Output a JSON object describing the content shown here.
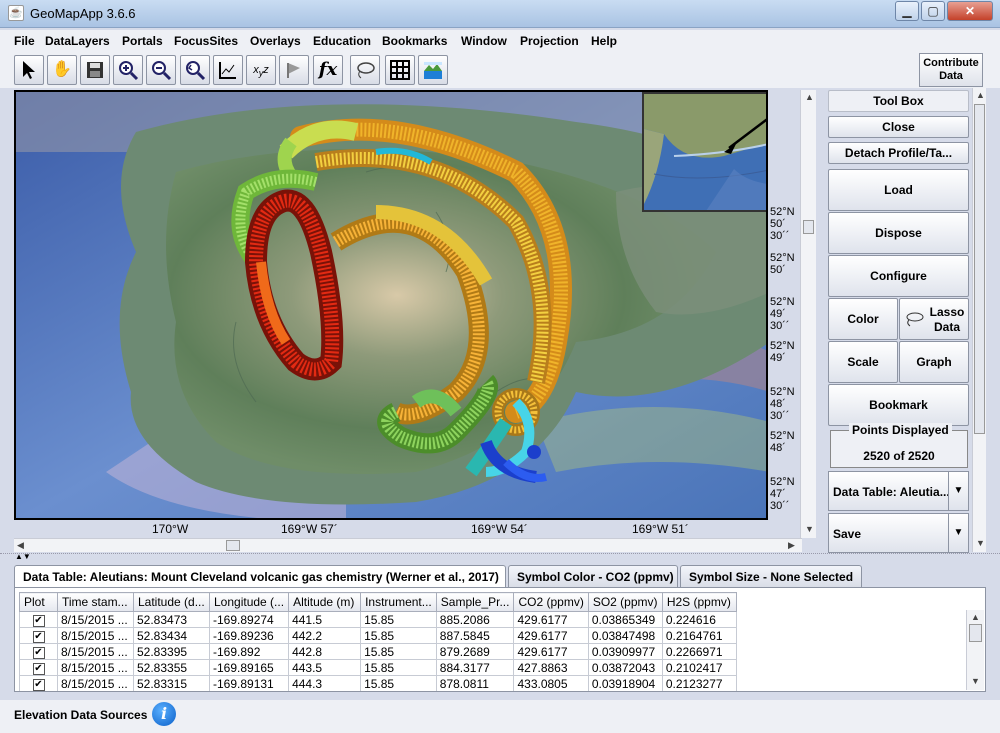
{
  "window": {
    "title": "GeoMapApp 3.6.6"
  },
  "menu": [
    "File",
    "DataLayers",
    "Portals",
    "FocusSites",
    "Overlays",
    "Education",
    "Bookmarks",
    "Window",
    "Projection",
    "Help"
  ],
  "toolbar": {
    "icons": [
      "select-arrow-icon",
      "pan-hand-icon",
      "save-icon",
      "zoom-in-icon",
      "zoom-out-icon",
      "zoom-back-icon",
      "graph-profile-icon",
      "xyz-icon",
      "flag-icon",
      "function-icon",
      "lasso-icon",
      "grid-icon",
      "layers-icon"
    ],
    "contribute_label": "Contribute Data"
  },
  "map": {
    "lat_labels": [
      [
        "52°N",
        "50´",
        "30´´"
      ],
      [
        "52°N",
        "50´"
      ],
      [
        "52°N",
        "49´",
        "30´´"
      ],
      [
        "52°N",
        "49´"
      ],
      [
        "52°N",
        "48´",
        "30´´"
      ],
      [
        "52°N",
        "48´"
      ],
      [
        "52°N",
        "47´",
        "30´´"
      ]
    ],
    "lon_labels": [
      "170°W",
      "169°W 57´",
      "169°W 54´",
      "169°W 51´"
    ]
  },
  "toolbox": {
    "title": "Tool Box",
    "close": "Close",
    "detach": "Detach Profile/Ta...",
    "load": "Load",
    "dispose": "Dispose",
    "configure": "Configure",
    "color": "Color",
    "lasso": "Lasso Data",
    "scale": "Scale",
    "graph": "Graph",
    "bookmark": "Bookmark",
    "points_title": "Points Displayed",
    "points_value": "2520 of 2520",
    "data_table_select": "Data Table: Aleutia...",
    "save_select": "Save"
  },
  "tabs": [
    "Data Table: Aleutians: Mount Cleveland volcanic gas chemistry (Werner et al., 2017)",
    "Symbol Color - CO2 (ppmv)",
    "Symbol Size - None Selected"
  ],
  "table": {
    "headers": [
      "Plot",
      "Time stam...",
      "Latitude (d...",
      "Longitude (...",
      "Altitude (m)",
      "Instrument...",
      "Sample_Pr...",
      "CO2 (ppmv)",
      "SO2 (ppmv)",
      "H2S (ppmv)"
    ],
    "rows": [
      [
        "✔",
        "8/15/2015 ...",
        "52.83473",
        "-169.89274",
        "441.5",
        "15.85",
        "885.2086",
        "429.6177",
        "0.03865349",
        "0.224616"
      ],
      [
        "✔",
        "8/15/2015 ...",
        "52.83434",
        "-169.89236",
        "442.2",
        "15.85",
        "887.5845",
        "429.6177",
        "0.03847498",
        "0.2164761"
      ],
      [
        "✔",
        "8/15/2015 ...",
        "52.83395",
        "-169.892",
        "442.8",
        "15.85",
        "879.2689",
        "429.6177",
        "0.03909977",
        "0.2266971"
      ],
      [
        "✔",
        "8/15/2015 ...",
        "52.83355",
        "-169.89165",
        "443.5",
        "15.85",
        "884.3177",
        "427.8863",
        "0.03872043",
        "0.2102417"
      ],
      [
        "✔",
        "8/15/2015 ...",
        "52.83315",
        "-169.89131",
        "444.3",
        "15.85",
        "878.0811",
        "433.0805",
        "0.03918904",
        "0.2123277"
      ]
    ]
  },
  "status": {
    "label": "Elevation Data Sources"
  }
}
